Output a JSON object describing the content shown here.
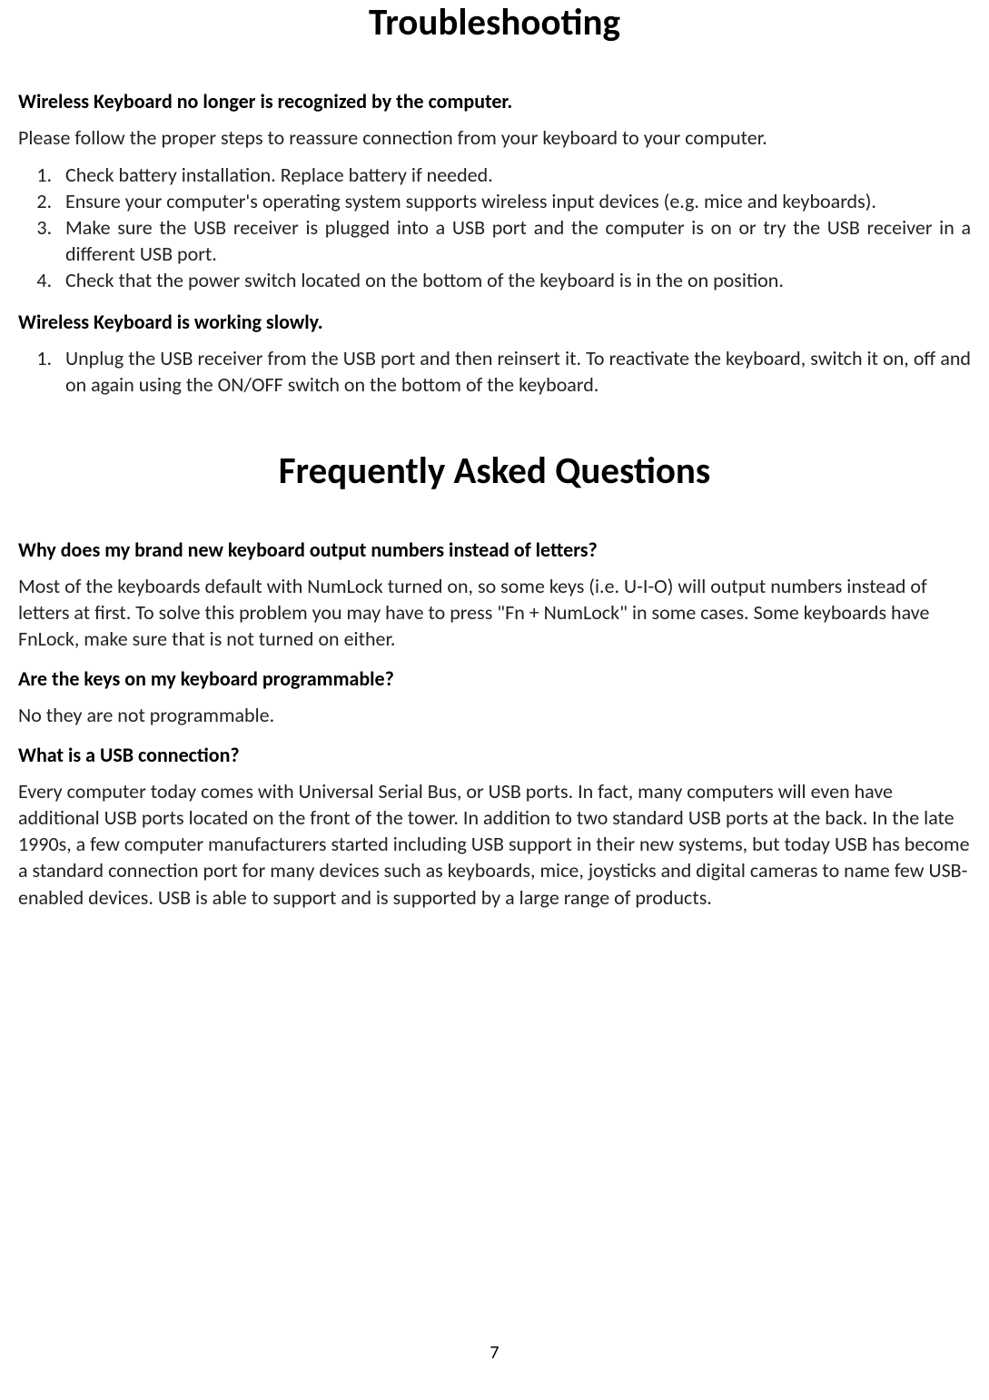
{
  "troubleshooting": {
    "title": "Troubleshooting",
    "section1": {
      "heading": "Wireless Keyboard no longer is recognized by the computer.",
      "intro": "Please follow the proper steps to reassure connection from your keyboard to your computer.",
      "steps": [
        "Check battery installation. Replace battery if needed.",
        "Ensure your computer's operating system supports wireless input devices (e.g. mice and keyboards).",
        "Make sure the USB receiver is plugged into a USB port and the computer is on or try the USB receiver in a different USB port.",
        "Check that the power switch located on the bottom of the keyboard is in the on position."
      ]
    },
    "section2": {
      "heading": "Wireless Keyboard is working slowly.",
      "steps": [
        "Unplug the USB receiver from the USB port and then reinsert it. To reactivate the keyboard, switch it on, off and on again using the ON/OFF switch on the bottom of the keyboard."
      ]
    }
  },
  "faq": {
    "title": "Frequently Asked Questions",
    "q1": {
      "question": "Why does my brand new keyboard output numbers instead of letters?",
      "answer": "Most of the keyboards default with NumLock turned on, so some keys (i.e. U-I-O) will output numbers instead of letters at first. To solve this problem you may have to press \"Fn + NumLock\" in some cases. Some keyboards have FnLock, make sure that is not turned on either."
    },
    "q2": {
      "question": "Are the keys on my keyboard programmable?",
      "answer": "No they are not programmable."
    },
    "q3": {
      "question": "What is a USB connection?",
      "answer": "Every computer today comes with Universal Serial Bus, or USB ports. In fact, many computers will even have additional USB ports located on the front of the tower. In addition to two standard USB ports at the back. In the late 1990s, a few computer manufacturers started including USB support in their new systems, but today USB has become a standard connection port for many devices such as keyboards, mice, joysticks and digital cameras to name few USB-enabled devices. USB is able to support and is supported by a large range of products."
    }
  },
  "page_number": "7"
}
